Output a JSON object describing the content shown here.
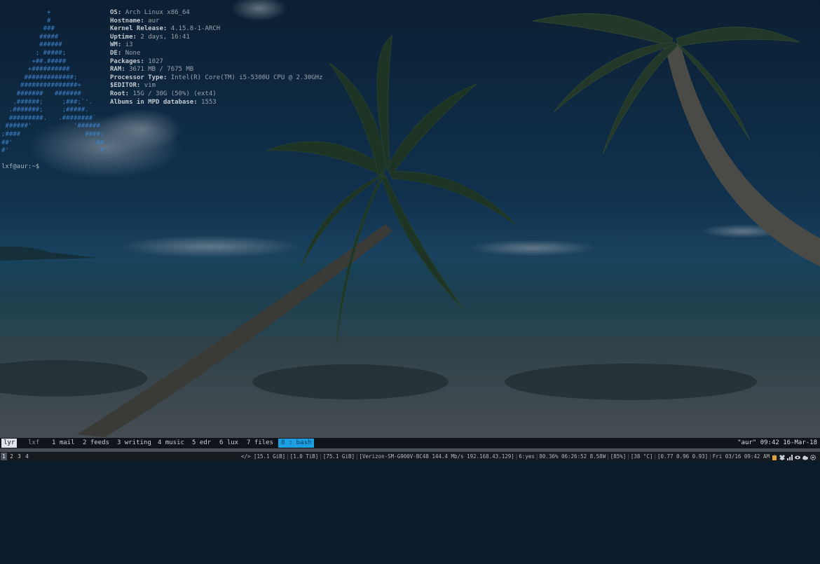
{
  "terminal": {
    "ascii_logo": [
      "            +",
      "            #",
      "           ###",
      "          #####",
      "          ######",
      "         ; #####;",
      "        +##.#####",
      "       +##########",
      "      #############;",
      "     ###############+",
      "    #######   #######",
      "   .######;     ;###;`'.",
      "  .#######;     ;#####.",
      "  #########.   .########`",
      " ######'           '######",
      ";####                 ####;",
      "##'                     '##",
      "#'                       `#"
    ],
    "sysinfo": [
      {
        "key": "OS:",
        "value": "Arch Linux x86_64"
      },
      {
        "key": "Hostname:",
        "value": "aur"
      },
      {
        "key": "Kernel Release:",
        "value": "4.15.8-1-ARCH"
      },
      {
        "key": "Uptime:",
        "value": "2 days, 16:41"
      },
      {
        "key": "WM:",
        "value": "i3"
      },
      {
        "key": "DE:",
        "value": "None"
      },
      {
        "key": "Packages:",
        "value": "1027"
      },
      {
        "key": "RAM:",
        "value": "3671 MB / 7675 MB"
      },
      {
        "key": "Processor Type:",
        "value": "Intel(R) Core(TM) i5-5300U CPU @ 2.30GHz"
      },
      {
        "key": "$EDITOR:",
        "value": "vim"
      },
      {
        "key": "Root:",
        "value": "15G / 30G (50%) (ext4)"
      },
      {
        "key": "Albums in MPD database:",
        "value": "1553"
      }
    ],
    "prompt": "lxf@aur:~$"
  },
  "tmux": {
    "sessions": [
      {
        "label": "lyr",
        "current": true
      },
      {
        "label": "lxf",
        "current": false
      }
    ],
    "windows": [
      {
        "label": "1 mail"
      },
      {
        "label": "2 feeds"
      },
      {
        "label": "3 writing"
      },
      {
        "label": "4 music"
      },
      {
        "label": "5 edr"
      },
      {
        "label": "6 lux"
      },
      {
        "label": "7 files"
      },
      {
        "label": "8 : bash",
        "active": true
      }
    ],
    "right": "\"aur\" 09:42 16-Mar-18"
  },
  "i3bar": {
    "workspaces": [
      "1",
      "2",
      "3",
      "4"
    ],
    "focused_workspace": "1",
    "blocks": [
      "</> [15.1 GiB]",
      "[1.0 TiB]",
      "[75.1 GiB]",
      "[Verizon-SM-G900V-BC48 144.4 Mb/s 192.168.43.129]",
      "6:yes",
      "80.36% 06:26:52 8.58W",
      "[85%]",
      "[38 °C]",
      "[0.77 0.96 0.93]",
      "Fri 03/16 09:42 AM"
    ],
    "tray_icons": [
      "clipboard-icon",
      "dropbox-icon",
      "network-icon",
      "eye-icon",
      "cloud-icon",
      "gear-icon"
    ]
  },
  "colors": {
    "logo_blue": "#3f82c9",
    "tmux_active_bg": "#1d9ee0",
    "sky": "#0b2238",
    "sea": "#1e3a4a",
    "sand": "#3a4550"
  }
}
